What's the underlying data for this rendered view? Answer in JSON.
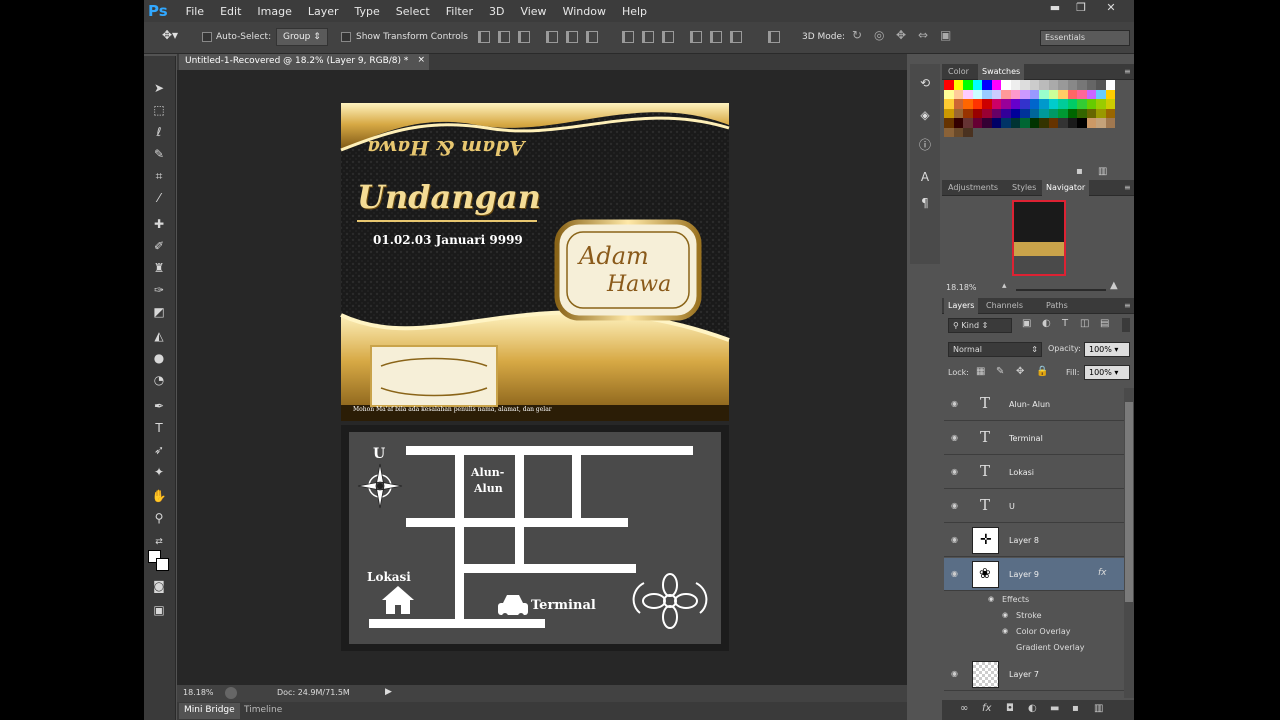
{
  "app": {
    "logo": "Ps"
  },
  "menu": [
    "File",
    "Edit",
    "Image",
    "Layer",
    "Type",
    "Select",
    "Filter",
    "3D",
    "View",
    "Window",
    "Help"
  ],
  "window_controls": {
    "minimize": "▬",
    "restore": "❐",
    "close": "✕"
  },
  "options_bar": {
    "move_tool_icon": "move-icon",
    "auto_select_label": "Auto-Select:",
    "auto_select_mode": "Group",
    "show_transform_label": "Show Transform Controls",
    "mode_3d_label": "3D Mode:",
    "workspace": "Essentials"
  },
  "document": {
    "tab_title": "Untitled-1-Recovered @ 18.2% (Layer 9, RGB/8) *",
    "close": "×"
  },
  "artwork": {
    "top_script": "Adam & Hawa",
    "title": "Undangan",
    "date": "01.02.03 Januari 9999",
    "frame_script_1": "Adam",
    "frame_script_2": "Hawa",
    "footer_note": "Mohon Ma'af bila ada kesalahan penulis nama, alamat, dan gelar",
    "map": {
      "north": "U",
      "alun_1": "Alun-",
      "alun_2": "Alun",
      "lokasi": "Lokasi",
      "terminal": "Terminal"
    }
  },
  "status": {
    "zoom": "18.18%",
    "doc": "Doc: 24.9M/71.5M"
  },
  "bottom_tabs": [
    "Mini Bridge",
    "Timeline"
  ],
  "panels": {
    "color_tabs": [
      "Color",
      "Swatches"
    ],
    "adj_tabs": [
      "Adjustments",
      "Styles",
      "Navigator"
    ],
    "nav_zoom": "18.18%",
    "layer_tabs": [
      "Layers",
      "Channels",
      "Paths"
    ],
    "kind": "Kind",
    "blend_mode": "Normal",
    "opacity_label": "Opacity:",
    "opacity": "100%",
    "lock_label": "Lock:",
    "fill_label": "Fill:",
    "fill": "100%",
    "layers": [
      {
        "name": "Alun- Alun",
        "type": "text"
      },
      {
        "name": "Terminal",
        "type": "text"
      },
      {
        "name": "Lokasi",
        "type": "text"
      },
      {
        "name": "U",
        "type": "text"
      },
      {
        "name": "Layer 8",
        "type": "image"
      },
      {
        "name": "Layer 9",
        "type": "image",
        "selected": true
      }
    ],
    "effects_label": "Effects",
    "effects": [
      "Stroke",
      "Color Overlay",
      "Gradient Overlay"
    ],
    "layer_after": "Layer 7",
    "fx": "fx"
  },
  "colors": {
    "accent": "#31a8ff",
    "gold": "#c9a34a",
    "panel": "#535353"
  }
}
